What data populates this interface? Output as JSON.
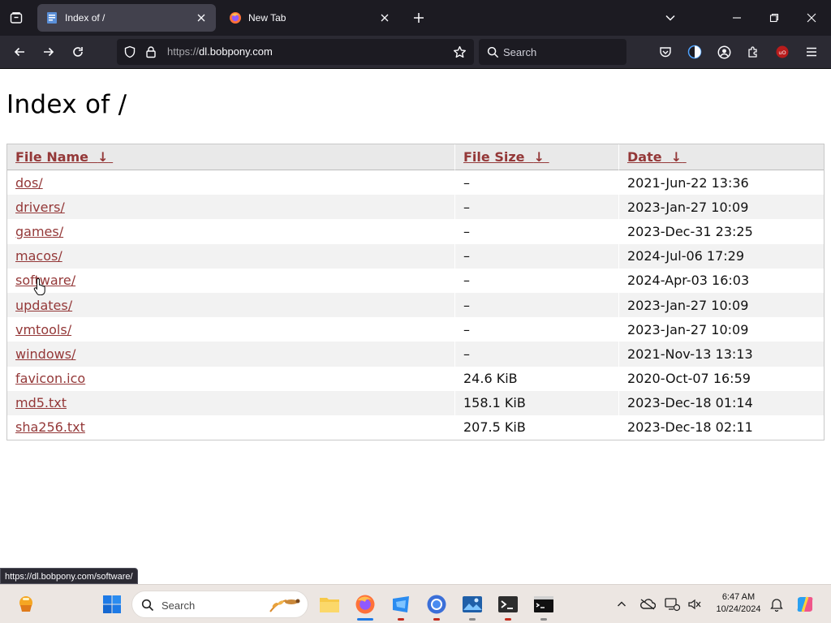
{
  "browser": {
    "tabs": [
      {
        "title": "Index of /",
        "active": true
      },
      {
        "title": "New Tab",
        "active": false
      }
    ],
    "url_scheme": "https://",
    "url_host": "dl.bobpony.com",
    "search_placeholder": "Search",
    "status_url": "https://dl.bobpony.com/software/"
  },
  "page": {
    "title": "Index of /",
    "columns": {
      "name": "File Name",
      "size": "File Size",
      "date": "Date",
      "sort_arrow": "↓"
    },
    "rows": [
      {
        "name": "dos/",
        "size": "–",
        "date": "2021-Jun-22 13:36"
      },
      {
        "name": "drivers/",
        "size": "–",
        "date": "2023-Jan-27 10:09"
      },
      {
        "name": "games/",
        "size": "–",
        "date": "2023-Dec-31 23:25"
      },
      {
        "name": "macos/",
        "size": "–",
        "date": "2024-Jul-06 17:29"
      },
      {
        "name": "software/",
        "size": "–",
        "date": "2024-Apr-03 16:03"
      },
      {
        "name": "updates/",
        "size": "–",
        "date": "2023-Jan-27 10:09"
      },
      {
        "name": "vmtools/",
        "size": "–",
        "date": "2023-Jan-27 10:09"
      },
      {
        "name": "windows/",
        "size": "–",
        "date": "2021-Nov-13 13:13"
      },
      {
        "name": "favicon.ico",
        "size": "24.6 KiB",
        "date": "2020-Oct-07 16:59"
      },
      {
        "name": "md5.txt",
        "size": "158.1 KiB",
        "date": "2023-Dec-18 01:14"
      },
      {
        "name": "sha256.txt",
        "size": "207.5 KiB",
        "date": "2023-Dec-18 02:11"
      }
    ]
  },
  "taskbar": {
    "search_placeholder": "Search",
    "time": "6:47 AM",
    "date": "10/24/2024"
  },
  "colors": {
    "link": "#943838",
    "tabstrip": "#1c1b22",
    "navbar": "#2b2a33",
    "taskbar": "#ece6e2"
  }
}
